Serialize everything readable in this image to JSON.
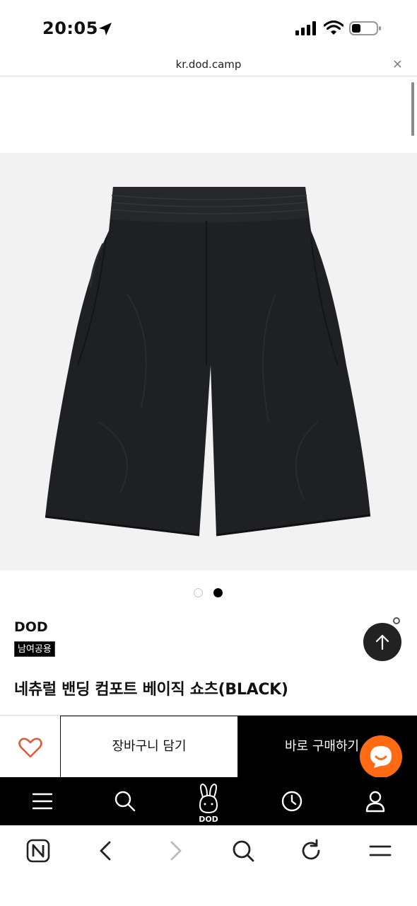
{
  "status_bar": {
    "time": "20:05"
  },
  "browser": {
    "url": "kr.dod.camp",
    "close_symbol": "×"
  },
  "product": {
    "image_name": "black-shorts-photo",
    "brand": "DOD",
    "badge": "남여공용",
    "title": "네츄럴 밴딩 컴포트 베이직 쇼츠(BLACK)",
    "carousel": {
      "total": 2,
      "active": 2
    }
  },
  "actions": {
    "wishlist_icon": "heart-outline-icon",
    "cart_label": "장바구니 담기",
    "buy_label": "바로 구매하기",
    "chat_icon": "chat-smile-icon"
  },
  "site_nav": {
    "logo_text": "DOD",
    "items": [
      "menu-icon",
      "search-icon",
      "rabbit-logo-icon",
      "clock-icon",
      "user-icon"
    ]
  },
  "browser_toolbar": {
    "items": [
      "naver-home-icon",
      "back-icon",
      "forward-icon",
      "search-icon",
      "reload-icon",
      "menu-icon"
    ]
  },
  "colors": {
    "accent_orange": "#ff6a13",
    "wishlist_heart": "#e15a3a",
    "nav_background": "#000000",
    "image_background": "#f2f2f2"
  }
}
